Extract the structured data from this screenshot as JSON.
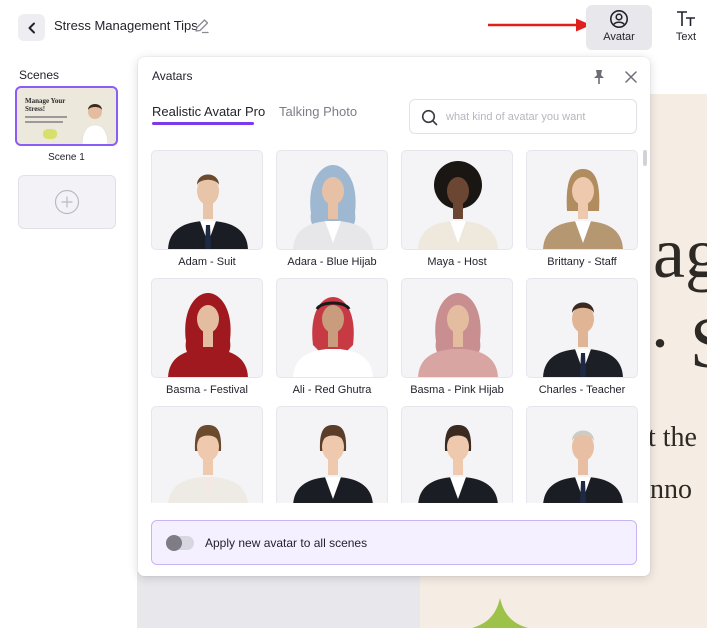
{
  "header": {
    "project_title": "Stress Management Tips",
    "avatar_label": "Avatar",
    "text_label": "Text"
  },
  "scenes": {
    "title": "Scenes",
    "items": [
      {
        "label": "Scene 1",
        "thumbnail_text": "Manage Your Stress!"
      }
    ]
  },
  "canvas": {
    "fragments": [
      "ag",
      "· S",
      "t the",
      "nno"
    ]
  },
  "avatar_panel": {
    "title": "Avatars",
    "tabs": [
      "Realistic Avatar Pro",
      "Talking Photo"
    ],
    "active_tab": "Realistic Avatar Pro",
    "search_placeholder": "what kind of avatar you want",
    "search_value": "",
    "avatars": [
      {
        "name": "Adam - Suit",
        "outfit": "#1b1d24",
        "hair": "#6b4a2e",
        "skin": "#e8c4a8",
        "shirt": "#ffffff",
        "headwear": "none",
        "tie": true
      },
      {
        "name": "Adara - Blue Hijab",
        "outfit": "#e7e7ea",
        "hair": "#9fb8d2",
        "skin": "#e7c1a6",
        "shirt": "#ffffff",
        "headwear": "hijab",
        "tie": false
      },
      {
        "name": "Maya - Host",
        "outfit": "#efe9dd",
        "hair": "#1a1614",
        "skin": "#6b4733",
        "shirt": "#ffffff",
        "headwear": "afro",
        "tie": false
      },
      {
        "name": "Brittany - Staff",
        "outfit": "#b59772",
        "hair": "#b08c5e",
        "skin": "#eec9ad",
        "shirt": "#ffffff",
        "headwear": "long",
        "tie": false
      },
      {
        "name": "Basma - Festival",
        "outfit": "#a0191f",
        "hair": "#a0191f",
        "skin": "#e4bda0",
        "shirt": "#a0191f",
        "headwear": "hijab",
        "tie": false
      },
      {
        "name": "Ali - Red Ghutra",
        "outfit": "#ffffff",
        "hair": "#c73a44",
        "skin": "#c99c7e",
        "shirt": "#ffffff",
        "headwear": "ghutra",
        "tie": false
      },
      {
        "name": "Basma - Pink Hijab",
        "outfit": "#d9a5a3",
        "hair": "#c98f90",
        "skin": "#e4bda0",
        "shirt": "#d9a5a3",
        "headwear": "hijab",
        "tie": false
      },
      {
        "name": "Charles - Teacher",
        "outfit": "#1d1f26",
        "hair": "#3a2a20",
        "skin": "#e0b596",
        "shirt": "#ffffff",
        "headwear": "none",
        "tie": true
      },
      {
        "name": "",
        "outfit": "#eeeae4",
        "hair": "#6b4a2e",
        "skin": "#eec9ad",
        "shirt": "#f3e9e4",
        "headwear": "bun",
        "tie": false
      },
      {
        "name": "",
        "outfit": "#1b1d24",
        "hair": "#5a3e2a",
        "skin": "#eec9ad",
        "shirt": "#ffffff",
        "headwear": "bun",
        "tie": false
      },
      {
        "name": "",
        "outfit": "#1b1d24",
        "hair": "#3a2a20",
        "skin": "#eec9ad",
        "shirt": "#ffffff",
        "headwear": "bun",
        "tie": false
      },
      {
        "name": "",
        "outfit": "#1b1d24",
        "hair": "#cfcac2",
        "skin": "#e8bfa2",
        "shirt": "#ffffff",
        "headwear": "none",
        "tie": true
      }
    ],
    "apply_all_label": "Apply new avatar to all scenes",
    "apply_all_enabled": false
  },
  "colors": {
    "accent": "#7c3aed",
    "annotation_arrow": "#e0201c"
  }
}
